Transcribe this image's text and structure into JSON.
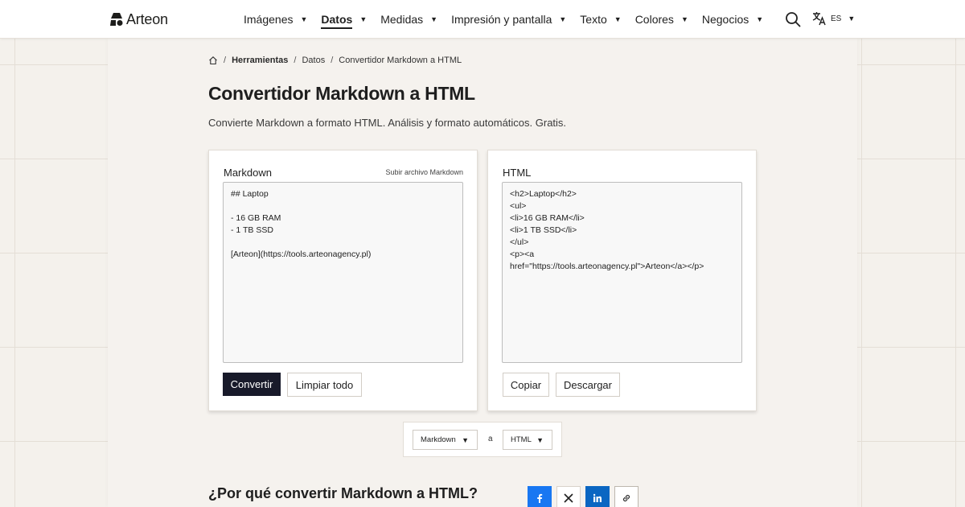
{
  "brand": {
    "name": "Arteon"
  },
  "nav": {
    "items": [
      {
        "label": "Imágenes",
        "active": false
      },
      {
        "label": "Datos",
        "active": true
      },
      {
        "label": "Medidas",
        "active": false
      },
      {
        "label": "Impresión y pantalla",
        "active": false
      },
      {
        "label": "Texto",
        "active": false
      },
      {
        "label": "Colores",
        "active": false
      },
      {
        "label": "Negocios",
        "active": false
      }
    ],
    "caret": "▼"
  },
  "language": {
    "code": "ES",
    "caret": "▼"
  },
  "breadcrumb": {
    "items": [
      "Herramientas",
      "Datos",
      "Convertidor Markdown a HTML"
    ],
    "separator": "/"
  },
  "page": {
    "title": "Convertidor Markdown a HTML",
    "subtitle": "Convierte Markdown a formato HTML. Análisis y formato automáticos. Gratis."
  },
  "input_card": {
    "title": "Markdown",
    "upload_link": "Subir archivo Markdown",
    "value": "## Laptop\n\n- 16 GB RAM\n- 1 TB SSD\n\n[Arteon](https://tools.arteonagency.pl)",
    "convert_label": "Convertir",
    "clear_label": "Limpiar todo"
  },
  "output_card": {
    "title": "HTML",
    "value": "<h2>Laptop</h2>\n<ul>\n<li>16 GB RAM</li>\n<li>1 TB SSD</li>\n</ul>\n<p><a\nhref=\"https://tools.arteonagency.pl\">Arteon</a></p>",
    "copy_label": "Copiar",
    "download_label": "Descargar"
  },
  "format_switcher": {
    "from": "Markdown",
    "connector": "a",
    "to": "HTML",
    "caret": "▼"
  },
  "section": {
    "why_title": "¿Por qué convertir Markdown a HTML?"
  },
  "share": {
    "icons": [
      "facebook-icon",
      "x-icon",
      "linkedin-icon",
      "link-icon"
    ],
    "colors": {
      "facebook": "#1877f2",
      "linkedin": "#0a66c2"
    }
  },
  "colors": {
    "primary_button": "#181a2a",
    "background": "#f4f1ec"
  }
}
